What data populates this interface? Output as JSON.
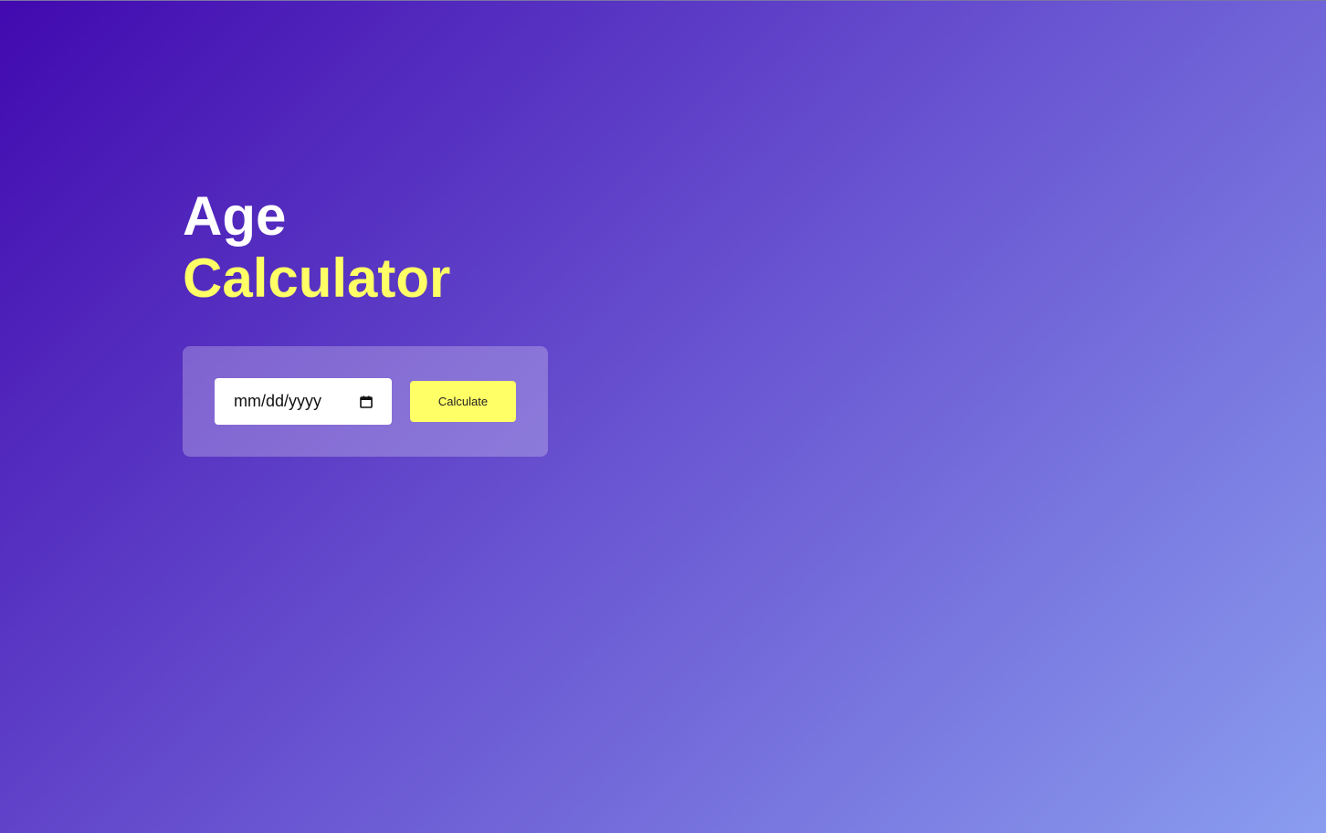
{
  "title": {
    "line1": "Age",
    "line2": "Calculator"
  },
  "form": {
    "date_input": {
      "placeholder": "mm/dd/yyyy",
      "value": ""
    },
    "calculate_label": "Calculate"
  },
  "icons": {
    "date_picker": "calendar-icon"
  },
  "colors": {
    "gradient_start": "#4109af",
    "gradient_end": "#8a9def",
    "accent_yellow": "#ffff66",
    "title_white": "#ffffff"
  }
}
